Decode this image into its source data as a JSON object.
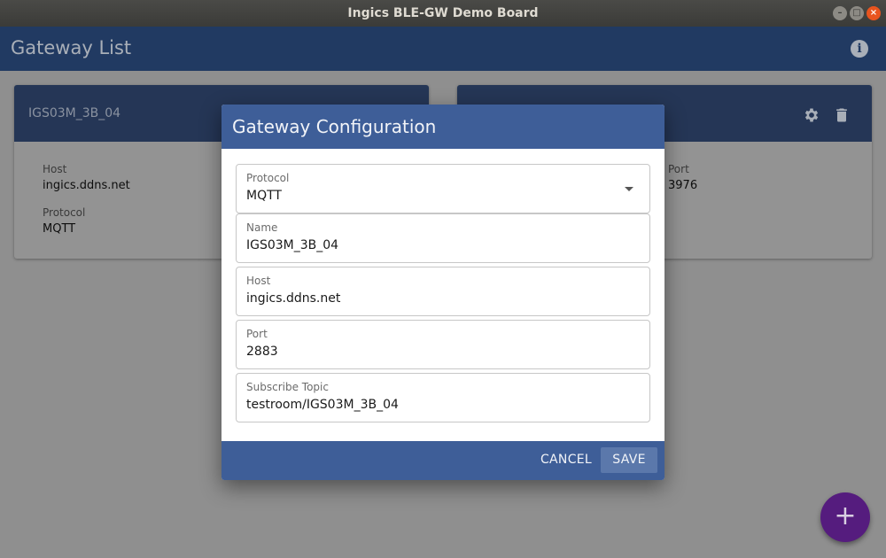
{
  "window": {
    "title": "Ingics BLE-GW Demo Board",
    "controls": {
      "minimize": "–",
      "maximize": "□",
      "close": "×"
    }
  },
  "appbar": {
    "title": "Gateway List",
    "info_icon": "info-icon"
  },
  "cards": [
    {
      "title": "IGS03M_3B_04",
      "host_label": "Host",
      "host_value": "ingics.ddns.net",
      "protocol_label": "Protocol",
      "protocol_value": "MQTT"
    },
    {
      "title": "",
      "port_label": "Port",
      "port_value": "3976",
      "icons": [
        "gear-icon",
        "trash-icon"
      ]
    }
  ],
  "dialog": {
    "title": "Gateway Configuration",
    "fields": {
      "protocol": {
        "label": "Protocol",
        "value": "MQTT"
      },
      "name": {
        "label": "Name",
        "value": "IGS03M_3B_04"
      },
      "host": {
        "label": "Host",
        "value": "ingics.ddns.net"
      },
      "port": {
        "label": "Port",
        "value": "2883"
      },
      "topic": {
        "label": "Subscribe Topic",
        "value": "testroom/IGS03M_3B_04"
      }
    },
    "cancel_label": "CANCEL",
    "save_label": "SAVE"
  },
  "fab": {
    "label": "+",
    "icon": "plus-icon"
  },
  "colors": {
    "appbar": "#213a62",
    "dialog_header": "#3e5e98",
    "fab": "#551c7e"
  }
}
